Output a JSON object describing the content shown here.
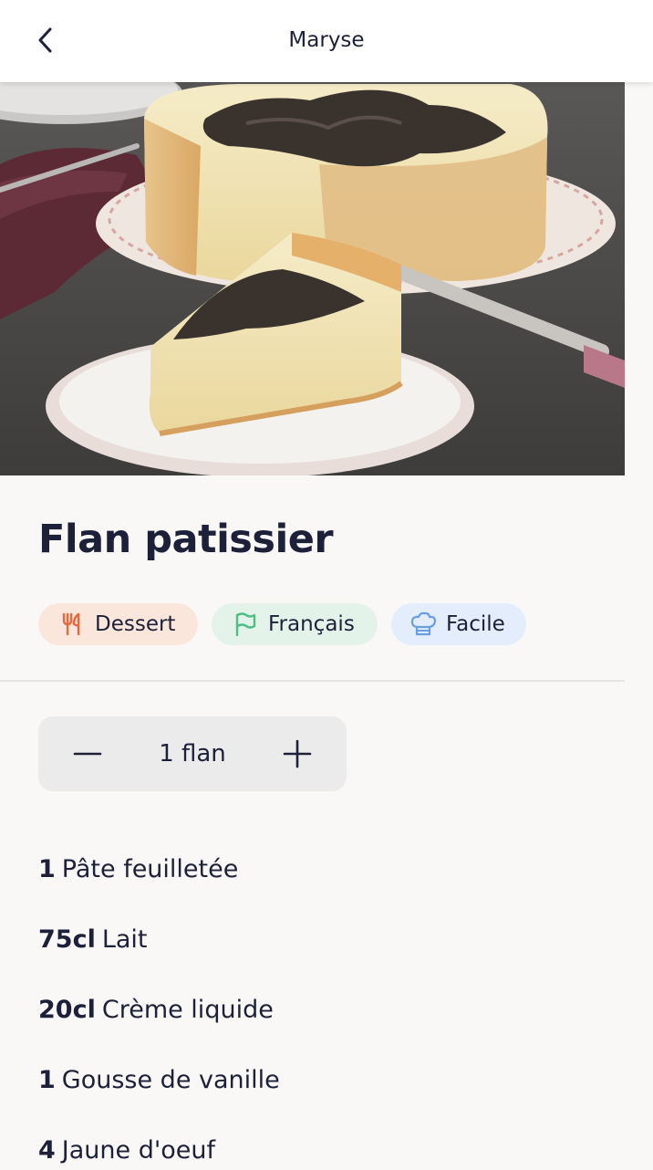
{
  "header": {
    "title": "Maryse",
    "back_icon": "chevron-left-icon"
  },
  "hero": {
    "image_subject": "flan patissier",
    "colors": {
      "plate": "#eee6df",
      "custard": "#f1e3b6",
      "crust": "#e3b777",
      "caramel": "#3a332d",
      "table": "#4c4a48"
    }
  },
  "recipe": {
    "title": "Flan patissier",
    "tags": [
      {
        "label": "Dessert",
        "icon": "fork-knife-icon",
        "bg": "#fbe6dc",
        "color": "#e56a3d"
      },
      {
        "label": "Français",
        "icon": "flag-icon",
        "bg": "#e4f3ea",
        "color": "#4dbf85"
      },
      {
        "label": "Facile",
        "icon": "chef-hat-icon",
        "bg": "#e4edfb",
        "color": "#6a9ee3"
      }
    ]
  },
  "servings": {
    "value": "1 flan",
    "minus_icon": "minus-icon",
    "plus_icon": "plus-icon"
  },
  "ingredients": [
    {
      "qty": "1",
      "name": "Pâte feuilletée"
    },
    {
      "qty": "75cl",
      "name": "Lait"
    },
    {
      "qty": "20cl",
      "name": "Crème liquide"
    },
    {
      "qty": "1",
      "name": "Gousse de vanille"
    },
    {
      "qty": "4",
      "name": "Jaune d'oeuf"
    }
  ]
}
